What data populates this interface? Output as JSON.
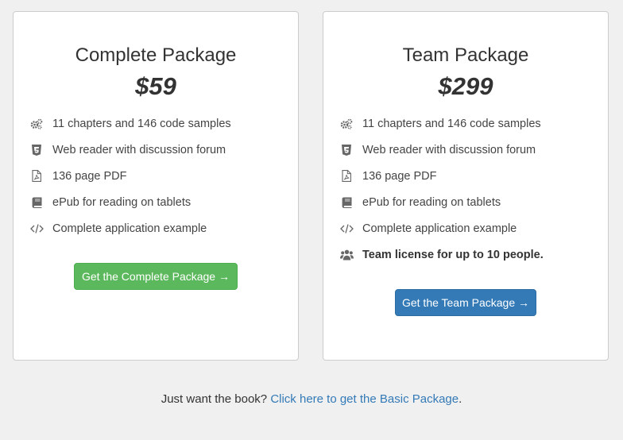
{
  "cards": [
    {
      "title": "Complete Package",
      "price": "$59",
      "features": [
        {
          "icon": "gears-icon",
          "text": "11 chapters and 146 code samples"
        },
        {
          "icon": "html5-icon",
          "text": "Web reader with discussion forum"
        },
        {
          "icon": "pdf-file-icon",
          "text": "136 page PDF"
        },
        {
          "icon": "book-icon",
          "text": "ePub for reading on tablets"
        },
        {
          "icon": "code-icon",
          "text": "Complete application example"
        }
      ],
      "button_label": "Get the Complete Package →",
      "button_color": "#5cb85c"
    },
    {
      "title": "Team Package",
      "price": "$299",
      "features": [
        {
          "icon": "gears-icon",
          "text": "11 chapters and 146 code samples"
        },
        {
          "icon": "html5-icon",
          "text": "Web reader with discussion forum"
        },
        {
          "icon": "pdf-file-icon",
          "text": "136 page PDF"
        },
        {
          "icon": "book-icon",
          "text": "ePub for reading on tablets"
        },
        {
          "icon": "code-icon",
          "text": "Complete application example"
        },
        {
          "icon": "users-icon",
          "text": "Team license for up to 10 people."
        }
      ],
      "button_label": "Get the Team Package →",
      "button_color": "#337ab7"
    }
  ],
  "footer": {
    "prefix": "Just want the book?",
    "link_text": "Click here to get the Basic Package",
    "suffix": "."
  },
  "colors": {
    "background": "#f0f0f0",
    "link": "#337ab7"
  }
}
